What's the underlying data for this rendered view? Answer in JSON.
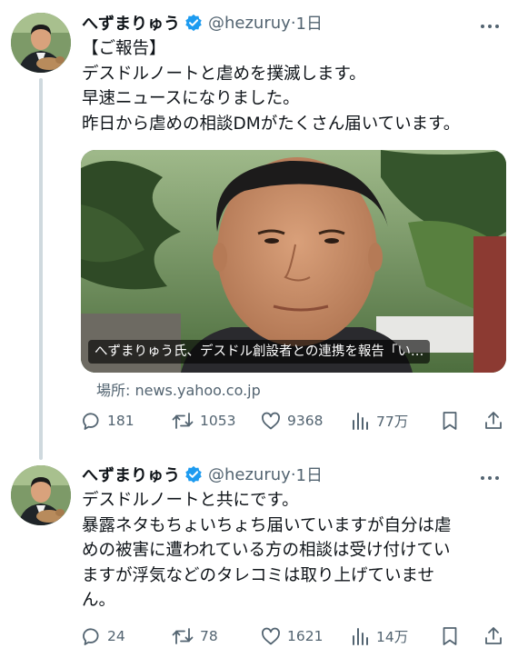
{
  "tweets": [
    {
      "author": {
        "name": "へずまりゅう",
        "handle": "@hezuruy",
        "separator": "·",
        "time": "1日"
      },
      "lines": [
        "【ご報告】",
        "デスドルノートと虐めを撲滅します。",
        "早速ニュースになりました。",
        "昨日から虐めの相談DMがたくさん届いています。"
      ],
      "card": {
        "caption": "へずまりゅう氏、デスドル創設者との連携を報告「い…",
        "source": "場所: news.yahoo.co.jp"
      },
      "stats": {
        "replies": "181",
        "retweets": "1053",
        "likes": "9368",
        "views": "77万"
      }
    },
    {
      "author": {
        "name": "へずまりゅう",
        "handle": "@hezuruy",
        "separator": "·",
        "time": "1日"
      },
      "lines": [
        "デスドルノートと共にです。",
        "暴露ネタもちょいちょち届いていますが自分は虐",
        "めの被害に遭われている方の相談は受け付けてい",
        "ますが浮気などのタレコミは取り上げていませ",
        "ん。"
      ],
      "stats": {
        "replies": "24",
        "retweets": "78",
        "likes": "1621",
        "views": "14万"
      }
    }
  ],
  "colors": {
    "text": "#0f1419",
    "secondary": "#536471",
    "verified": "#1d9bf0",
    "thread_line": "#cfd9de"
  },
  "icons": [
    "verified-badge-icon",
    "more-icon",
    "reply-icon",
    "retweet-icon",
    "like-icon",
    "views-icon",
    "bookmark-icon",
    "share-icon"
  ]
}
